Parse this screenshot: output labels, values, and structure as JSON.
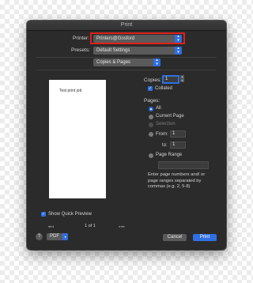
{
  "window": {
    "title": "Print"
  },
  "printer": {
    "label": "Printer:",
    "value": "Printers@Gosford"
  },
  "presets": {
    "label": "Presets:",
    "value": "Default Settings"
  },
  "section": {
    "value": "Copies & Pages"
  },
  "preview": {
    "text": "Test print job",
    "page_indicator": "1 of 1",
    "show_preview_label": "Show Quick Preview"
  },
  "copies": {
    "label": "Copies:",
    "value": "1",
    "collated_label": "Collated"
  },
  "pages": {
    "label": "Pages:",
    "all": "All",
    "current": "Current Page",
    "selection": "Selection",
    "from_label": "From:",
    "from_value": "1",
    "to_label": "to:",
    "to_value": "1",
    "range_label": "Page Range",
    "hint": "Enter page numbers and/ or page ranges separated by commas (e.g. 2, 5-8)"
  },
  "footer": {
    "help": "?",
    "pdf": "PDF",
    "cancel": "Cancel",
    "print": "Print"
  },
  "colors": {
    "accent": "#2f6fe0",
    "highlight": "#e0201c",
    "dialog_bg": "#2b2b2b"
  }
}
